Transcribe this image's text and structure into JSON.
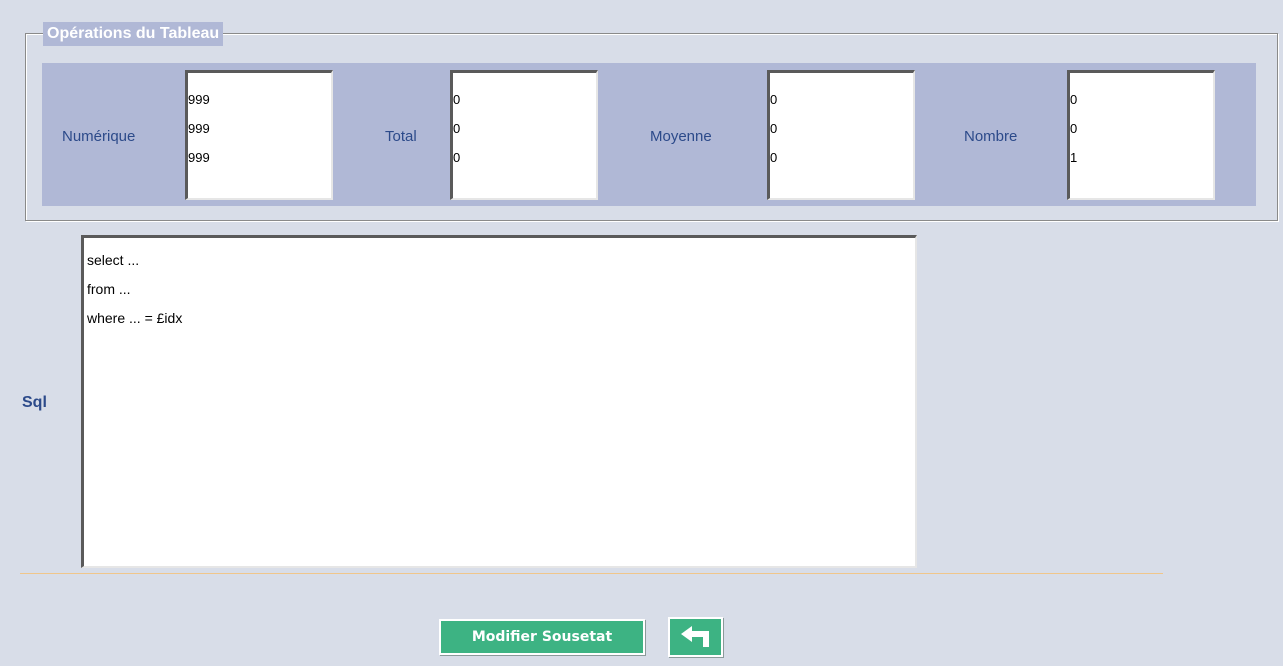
{
  "fieldset": {
    "legend": "Opérations du Tableau"
  },
  "operations": [
    {
      "label": "Numérique",
      "values": [
        "999",
        "999",
        "999"
      ]
    },
    {
      "label": "Total",
      "values": [
        "0",
        "0",
        "0"
      ]
    },
    {
      "label": "Moyenne",
      "values": [
        "0",
        "0",
        "0"
      ]
    },
    {
      "label": "Nombre",
      "values": [
        "0",
        "0",
        "1"
      ]
    }
  ],
  "sql": {
    "label": "Sql",
    "lines": [
      "select ...",
      "from ...",
      "where ... = £idx"
    ]
  },
  "actions": {
    "modify_label": "Modifier Sousetat",
    "back_icon": "return-arrow-icon"
  },
  "colors": {
    "background": "#d8dde8",
    "band": "#b0b8d6",
    "label_text": "#2c4a8a",
    "button": "#3db383",
    "divider": "#f0c68a"
  }
}
